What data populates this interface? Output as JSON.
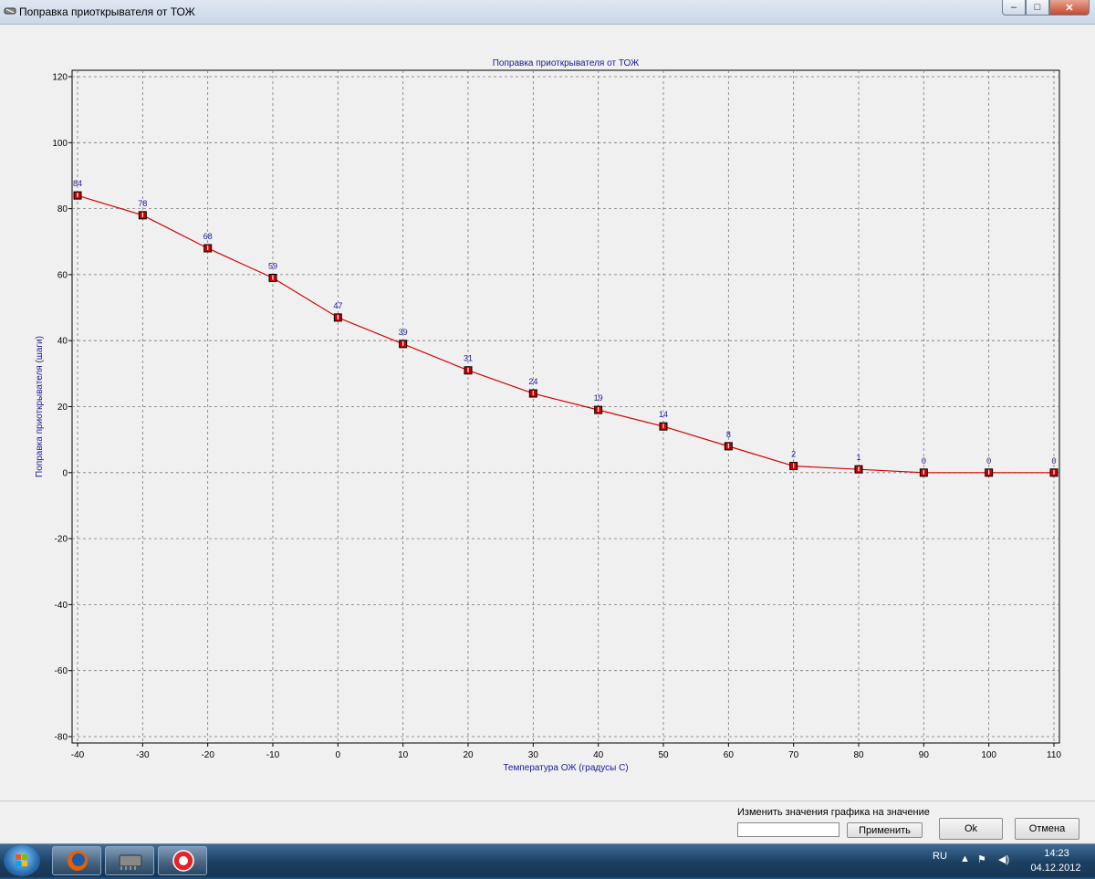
{
  "window": {
    "title": "Поправка приоткрывателя от ТОЖ",
    "buttons": {
      "minimize": "–",
      "maximize": "□",
      "close": "✕"
    }
  },
  "chart_data": {
    "type": "line",
    "title": "Поправка приоткрывателя от ТОЖ",
    "xlabel": "Температура ОЖ (градусы С)",
    "ylabel": "Поправка приоткрывателя (шаги)",
    "xlim": [
      -40,
      110
    ],
    "ylim": [
      -80,
      120
    ],
    "x_ticks": [
      -40,
      -30,
      -20,
      -10,
      0,
      10,
      20,
      30,
      40,
      50,
      60,
      70,
      80,
      90,
      100,
      110
    ],
    "y_ticks": [
      -80,
      -60,
      -40,
      -20,
      0,
      20,
      40,
      60,
      80,
      100,
      120
    ],
    "grid": true,
    "series": [
      {
        "x": [
          -40,
          -30,
          -20,
          -10,
          0,
          10,
          20,
          30,
          40,
          50,
          60,
          70,
          80,
          90,
          100,
          110
        ],
        "values": [
          84,
          78,
          68,
          59,
          47,
          39,
          31,
          24,
          19,
          14,
          8,
          2,
          1,
          0,
          0,
          0
        ],
        "color": "#d40000",
        "marker_color": "#cc0000"
      }
    ],
    "text_color": "#1a1a99"
  },
  "panel": {
    "edit_caption": "Изменить значения графика на значение",
    "input_value": "",
    "apply_label": "Применить",
    "ok_label": "Ok",
    "cancel_label": "Отмена"
  },
  "taskbar": {
    "language": "RU",
    "time": "14:23",
    "date": "04.12.2012",
    "apps": [
      "start-button",
      "firefox",
      "chip-program",
      "record-app"
    ]
  }
}
